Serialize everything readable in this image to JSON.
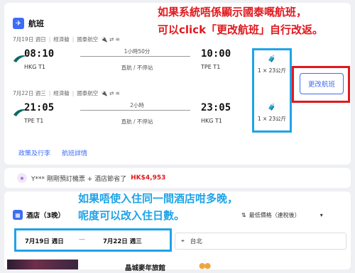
{
  "flight": {
    "section_title": "航班",
    "legs": [
      {
        "date": "7月19日 週日",
        "cabin": "經濟艙",
        "airline": "國泰航空",
        "dep_time": "08:10",
        "dep_airport": "HKG T1",
        "duration": "1小時50分",
        "stops": "直航 / 不停站",
        "arr_time": "10:00",
        "arr_airport": "TPE T1",
        "baggage": "1 × 23公斤"
      },
      {
        "date": "7月22日 週三",
        "cabin": "經濟艙",
        "airline": "國泰航空",
        "dep_time": "21:05",
        "dep_airport": "TPE T1",
        "duration": "2小時",
        "stops": "直航 / 不停站",
        "arr_time": "23:05",
        "arr_airport": "HKG T1",
        "baggage": "1 × 23公斤"
      }
    ],
    "change_button": "更改航班",
    "links": {
      "policy": "政策及行李",
      "details": "航班詳情"
    }
  },
  "promo": {
    "text": "Y*** 剛剛預訂機票 + 酒店節省了",
    "amount": "HK$4,953"
  },
  "hotel": {
    "section_title": "酒店（3晚）",
    "sort_label": "最低價格（連稅後）",
    "check_in": "7月19日 週日",
    "check_out": "7月22日 週三",
    "date_sep": "—",
    "location": "台北",
    "first_hotel_name": "晶城麥年旅館"
  },
  "annotations": {
    "red_line1": "如果系統唔係顯示國泰嘅航班，",
    "red_line2": "可以click「更改航班」自行改返。",
    "blue_line1": "如果唔使入住同一間酒店咁多晚，",
    "blue_line2": "呢度可以改入住日數。"
  },
  "colors": {
    "accent_blue": "#3b6df5",
    "annotation_red": "#e0191e",
    "annotation_blue": "#1ea3e8",
    "price_red": "#e0191e"
  }
}
